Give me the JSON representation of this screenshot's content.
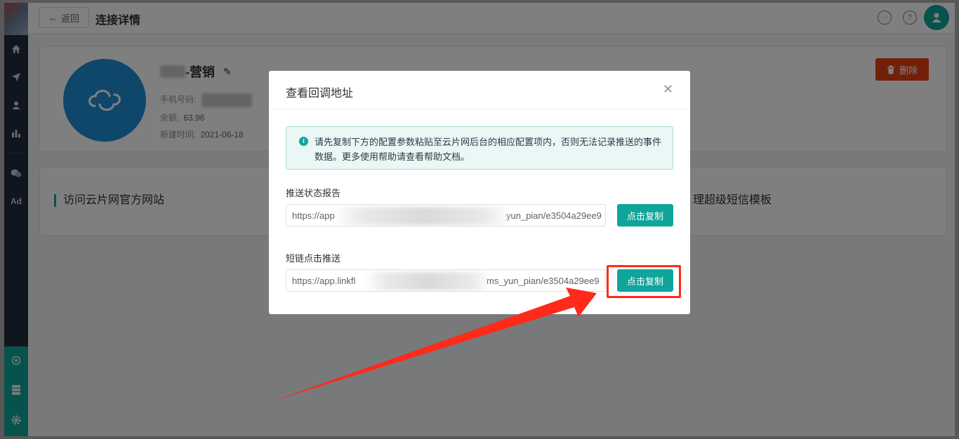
{
  "header": {
    "back_label": "返回",
    "title": "连接详情"
  },
  "sidebar": {
    "items": [
      {
        "icon": "home-icon"
      },
      {
        "icon": "send-icon"
      },
      {
        "icon": "user-icon"
      },
      {
        "icon": "bar-chart-icon"
      },
      {
        "icon": "wechat-icon"
      },
      {
        "icon": "ad-icon",
        "label": "Ad"
      }
    ],
    "bottom_items": [
      {
        "icon": "integration-icon"
      },
      {
        "icon": "server-icon"
      },
      {
        "icon": "gear-icon"
      }
    ]
  },
  "profile": {
    "name_suffix": "-营销",
    "phone_label": "手机号码:",
    "balance_label": "余额:",
    "balance": "63.96",
    "created_label": "新建时间:",
    "created": "2021-06-18",
    "delete_label": "删除"
  },
  "links": {
    "left": "访问云片网官方网站",
    "right": "理超级短信模板"
  },
  "modal": {
    "title": "查看回调地址",
    "alert": "请先复制下方的配置参数粘贴至云片网后台的相应配置项内，否则无法记录推送的事件数据。更多使用帮助请查看帮助文档。",
    "fields": [
      {
        "label": "推送状态报告",
        "value_start": "https://app",
        "value_end": "yun_pian/e3504a29ee9",
        "button": "点击复制"
      },
      {
        "label": "短链点击推送",
        "value_start": "https://app.linkfl",
        "value_end": "ms_yun_pian/e3504a29ee9",
        "button": "点击复制"
      }
    ]
  },
  "colors": {
    "sidebar": "#1f2d3d",
    "accent": "#10a59a",
    "danger": "#e4400f",
    "annotation": "#ff2a1a"
  }
}
